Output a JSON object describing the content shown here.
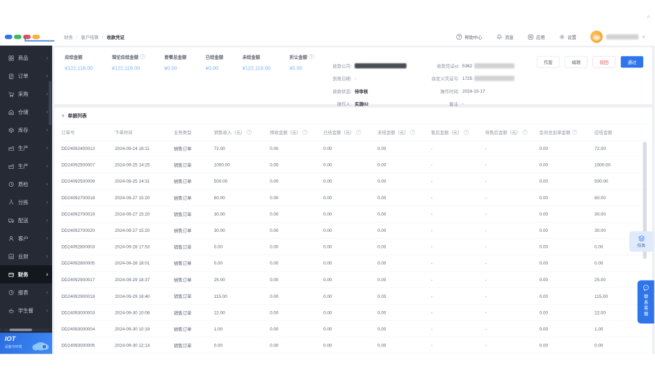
{
  "breadcrumb": {
    "items": [
      "财务",
      "客户结算",
      "收款凭证"
    ]
  },
  "topbar": {
    "help": "帮助中心",
    "messages": "消息",
    "apps": "应用",
    "settings": "设置"
  },
  "sidebar": {
    "items": [
      {
        "label": "商品",
        "icon": "goods-icon"
      },
      {
        "label": "订单",
        "icon": "order-icon"
      },
      {
        "label": "采购",
        "icon": "purchase-icon"
      },
      {
        "label": "仓储",
        "icon": "warehouse-icon"
      },
      {
        "label": "库存",
        "icon": "inventory-icon"
      },
      {
        "label": "生产",
        "icon": "production-icon"
      },
      {
        "label": "生产",
        "icon": "production-icon"
      },
      {
        "label": "质检",
        "icon": "quality-icon"
      },
      {
        "label": "分拣",
        "icon": "sorting-icon"
      },
      {
        "label": "配送",
        "icon": "delivery-icon"
      },
      {
        "label": "客户",
        "icon": "customer-icon"
      },
      {
        "label": "业财",
        "icon": "bizfinance-icon"
      },
      {
        "label": "财务",
        "icon": "finance-icon",
        "active": true
      },
      {
        "label": "报表",
        "icon": "report-icon"
      },
      {
        "label": "学生餐",
        "icon": "meal-icon"
      }
    ],
    "iot": {
      "title": "IOT",
      "subtitle": "设备与环境"
    }
  },
  "summary": {
    "metrics": [
      {
        "label": "应结金额",
        "value": "¥122,118.00",
        "info": false
      },
      {
        "label": "理论应结金额",
        "value": "¥122,118.00",
        "info": true
      },
      {
        "label": "套餐总金额",
        "value": "¥0.00",
        "info": false
      },
      {
        "label": "已结金额",
        "value": "¥0.00",
        "info": false
      },
      {
        "label": "未结金额",
        "value": "¥122,118.00",
        "info": false
      },
      {
        "label": "折让金额",
        "value": "¥0.00",
        "info": true
      }
    ],
    "actions": {
      "void": "作废",
      "edit": "编辑",
      "reject": "驳回",
      "approve": "通过"
    }
  },
  "details": {
    "left": [
      {
        "label": "收款公司:",
        "value": "",
        "redacted": "dark"
      },
      {
        "label": "到账日期:",
        "value": "-"
      },
      {
        "label": "收款状态:",
        "value": "待审核",
        "bold": true
      },
      {
        "label": "操作人:",
        "value": "实施02",
        "bold": true
      }
    ],
    "right": [
      {
        "label": "收款凭证id:",
        "value": "5362",
        "redacted": "light"
      },
      {
        "label": "自定义凭证号:",
        "value": "1725",
        "redacted": "light"
      },
      {
        "label": "操作时间:",
        "value": "2024-10-17"
      },
      {
        "label": "备注:",
        "value": "-"
      }
    ]
  },
  "table": {
    "section_title": "单据列表",
    "columns": [
      {
        "label": "订单号",
        "info": false
      },
      {
        "label": "下单时间",
        "info": false
      },
      {
        "label": "业务类型",
        "info": false
      },
      {
        "label": "销售收入（元）",
        "info": true
      },
      {
        "label": "预收金额（元）",
        "info": true
      },
      {
        "label": "已结金额（元）",
        "info": true
      },
      {
        "label": "未结金额（元）",
        "info": true
      },
      {
        "label": "售后金额（元）",
        "info": true
      },
      {
        "label": "待售后金额（元）",
        "info": true
      },
      {
        "label": "会员总加单金额",
        "info": true
      },
      {
        "label": "应结金额",
        "info": false
      }
    ],
    "rows": [
      [
        "DD24092400013",
        "2024-09-24 18:11",
        "销售订单",
        "72.00",
        "0.00",
        "0.00",
        "0.00",
        "-",
        "-",
        "0.00",
        "72.00"
      ],
      [
        "DD24092500007",
        "2024-09-25 14:25",
        "销售订单",
        "1000.00",
        "0.00",
        "0.00",
        "0.00",
        "-",
        "-",
        "0.00",
        "1000.00"
      ],
      [
        "DD24092500009",
        "2024-09-25 14:31",
        "销售订单",
        "500.00",
        "0.00",
        "0.00",
        "0.00",
        "-",
        "-",
        "0.00",
        "500.00"
      ],
      [
        "DD24092700018",
        "2024-09-27 15:20",
        "销售订单",
        "60.00",
        "0.00",
        "0.00",
        "0.00",
        "-",
        "-",
        "0.00",
        "60.00"
      ],
      [
        "DD24092700019",
        "2024-09-27 15:20",
        "销售订单",
        "30.00",
        "0.00",
        "0.00",
        "0.00",
        "-",
        "-",
        "0.00",
        "30.00"
      ],
      [
        "DD24092700020",
        "2024-09-27 15:20",
        "销售订单",
        "30.00",
        "0.00",
        "0.00",
        "0.00",
        "-",
        "-",
        "0.00",
        "30.00"
      ],
      [
        "DD24092800003",
        "2024-09-28 17:53",
        "销售订单",
        "0.00",
        "0.00",
        "0.00",
        "0.00",
        "-",
        "-",
        "0.00",
        "0.00"
      ],
      [
        "DD24092800005",
        "2024-09-28 18:01",
        "销售订单",
        "0.00",
        "0.00",
        "0.00",
        "0.00",
        "-",
        "-",
        "0.00",
        "0.00"
      ],
      [
        "DD24092900017",
        "2024-09-29 18:37",
        "销售订单",
        "25.00",
        "0.00",
        "0.00",
        "0.00",
        "-",
        "-",
        "0.00",
        "25.00"
      ],
      [
        "DD24092900018",
        "2024-09-29 18:40",
        "销售订单",
        "115.00",
        "0.00",
        "0.00",
        "0.00",
        "-",
        "-",
        "0.00",
        "115.00"
      ],
      [
        "DD24093000003",
        "2024-09-30 10:08",
        "销售订单",
        "22.00",
        "0.00",
        "0.00",
        "0.00",
        "-",
        "-",
        "0.00",
        "22.00"
      ],
      [
        "DD24093000004",
        "2024-09-30 10:19",
        "销售订单",
        "1.00",
        "0.00",
        "0.00",
        "0.00",
        "-",
        "-",
        "0.00",
        "1.00"
      ],
      [
        "DD24093000005",
        "2024-09-30 12:14",
        "销售订单",
        "0.00",
        "0.00",
        "0.00",
        "0.00",
        "-",
        "-",
        "0.00",
        "0.00"
      ]
    ]
  },
  "floating": {
    "task": "任务",
    "service": "联系客服"
  },
  "colors": {
    "accent": "#2e74eb",
    "value_blue": "#7ab1f0",
    "danger": "#e25050",
    "sidebar_bg": "#252a35",
    "main_bg": "#eef0f4",
    "logo_pills": [
      "#2e74eb",
      "#3dbb63",
      "#e8514f",
      "#f6b23e"
    ]
  }
}
